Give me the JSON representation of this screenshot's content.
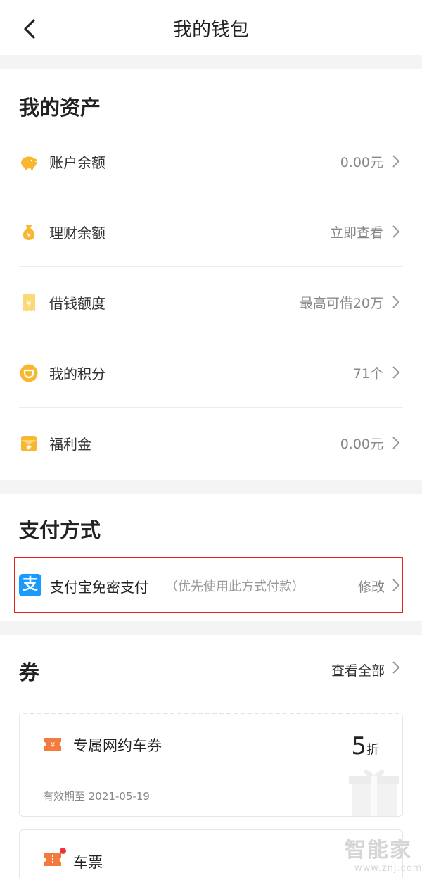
{
  "header": {
    "title": "我的钱包",
    "back_icon": "back-arrow-icon"
  },
  "assets": {
    "title": "我的资产",
    "items": [
      {
        "label": "账户余额",
        "value": "0.00元",
        "icon": "piggy-bank-icon",
        "color": "#f7b731"
      },
      {
        "label": "理财余额",
        "value": "立即查看",
        "icon": "money-bag-icon",
        "color": "#f7b731"
      },
      {
        "label": "借钱额度",
        "value": "最高可借20万",
        "icon": "yuan-receipt-icon",
        "color": "#f7b731"
      },
      {
        "label": "我的积分",
        "value": "71个",
        "icon": "points-coin-icon",
        "color": "#f7b731"
      },
      {
        "label": "福利金",
        "value": "0.00元",
        "icon": "welfare-envelope-icon",
        "color": "#f7b731"
      }
    ]
  },
  "payment": {
    "title": "支付方式",
    "method_label": "支付宝免密支付",
    "method_note": "（优先使用此方式付款）",
    "action": "修改",
    "icon": "alipay-icon",
    "icon_glyph": "支",
    "brand_color": "#1a9bfc",
    "highlight_color": "#e02424"
  },
  "coupons": {
    "title": "券",
    "view_all": "查看全部",
    "items": [
      {
        "name": "专属网约车券",
        "discount_number": "5",
        "discount_unit": "折",
        "expiry": "有效期至 2021-05-19",
        "icon": "ticket-yuan-icon",
        "color": "#f47b3f"
      },
      {
        "name": "车票",
        "icon": "train-ticket-icon",
        "color": "#f47b3f"
      }
    ]
  },
  "watermark": {
    "main": "智能家",
    "sub": "www.znj.com"
  }
}
